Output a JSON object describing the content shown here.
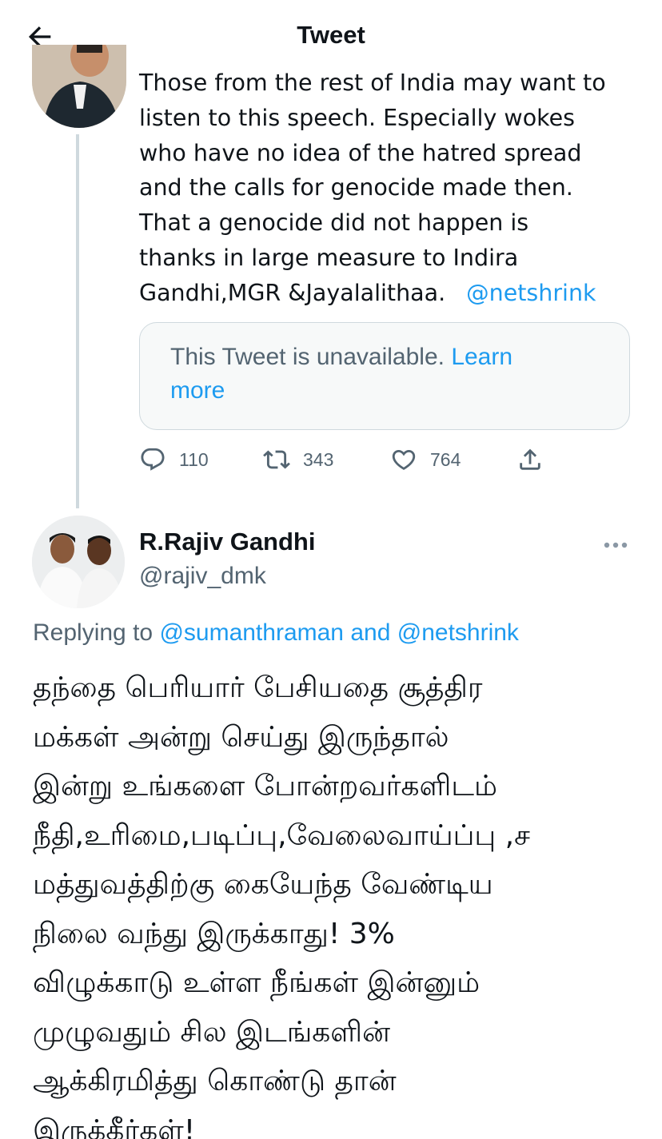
{
  "header": {
    "title": "Tweet"
  },
  "quoted_tweet": {
    "lines": [
      "Those from the rest of India may want to",
      "listen to this speech. Especially wokes",
      "who have no idea of the hatred spread",
      "and the calls for genocide made then.",
      "That a genocide did not happen is",
      "thanks in large measure to Indira",
      "Gandhi,MGR &Jayalalithaa."
    ],
    "mention": "@netshrink",
    "embedded": {
      "text": "This Tweet is unavailable.",
      "link": "Learn",
      "link_cont": "more"
    },
    "stats": {
      "replies": "110",
      "retweets": "343",
      "likes": "764"
    }
  },
  "reply_tweet": {
    "author_name": "R.Rajiv Gandhi",
    "author_handle": "@rajiv_dmk",
    "replying_prefix": "Replying to",
    "replying_to_1": "@sumanthraman",
    "replying_and": "and",
    "replying_to_2": "@netshrink",
    "lines": [
      "தந்தை பெரியார் பேசியதை சூத்திர",
      "மக்கள் அன்று செய்து இருந்தால்",
      "இன்று உங்களை போன்றவர்களிடம்",
      "நீதி,உரிமை,படிப்பு,வேலைவாய்ப்பு ,ச",
      "மத்துவத்திற்கு கையேந்த வேண்டிய",
      "நிலை வந்து இருக்காது! 3%",
      "விழுக்காடு உள்ள நீங்கள் இன்னும்",
      "முழுவதும் சில இடங்களின்",
      "ஆக்கிரமித்து கொண்டு தான்",
      "இருக்கீர்கள்!"
    ]
  },
  "icons": {
    "back": "arrow-left-icon",
    "reply": "speech-bubble-icon",
    "retweet": "retweet-icon",
    "like": "heart-icon",
    "share": "share-icon",
    "more": "ellipsis-icon"
  },
  "colors": {
    "link": "#1d9bf0",
    "secondary_text": "#536471",
    "border": "#cfd9de"
  }
}
